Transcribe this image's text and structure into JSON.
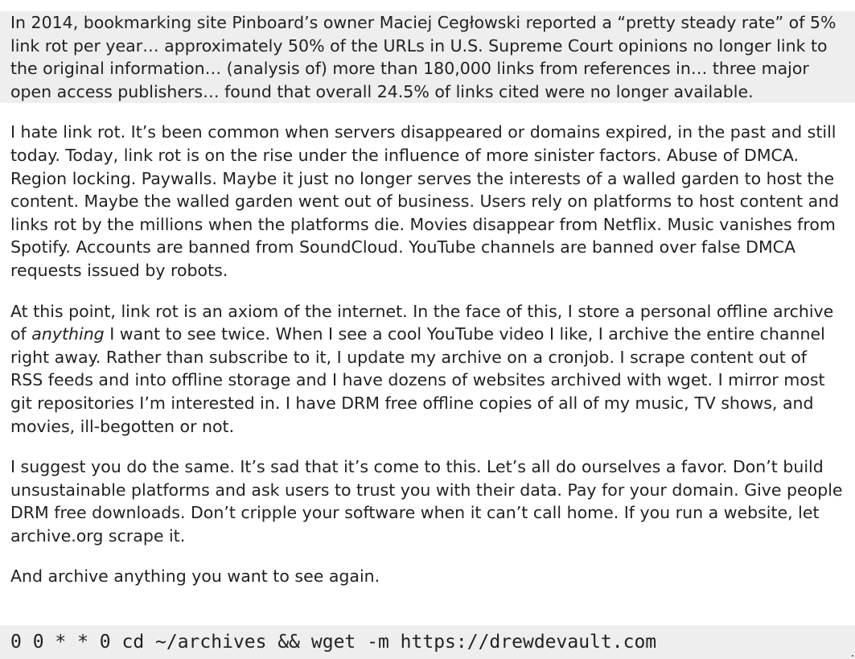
{
  "quote": "In 2014, bookmarking site Pinboard’s owner Maciej Cegłowski reported a “pretty steady rate” of 5% link rot per year… approximately 50% of the URLs in U.S. Supreme Court opinions no longer link to the original information… (analysis of) more than 180,000 links from references in… three major open access publishers… found that overall 24.5% of links cited were no longer available.",
  "paragraphs": {
    "p1": "I hate link rot. It’s been common when servers disappeared or domains expired, in the past and still today. Today, link rot is on the rise under the influence of more sinister factors. Abuse of DMCA. Region locking. Paywalls. Maybe it just no longer serves the interests of a walled garden to host the content. Maybe the walled garden went out of business. Users rely on platforms to host content and links rot by the millions when the platforms die. Movies disappear from Netflix. Music vanishes from Spotify. Accounts are banned from SoundCloud. YouTube channels are banned over false DMCA requests issued by robots.",
    "p2_before": "At this point, link rot is an axiom of the internet. In the face of this, I store a personal offline archive of ",
    "p2_emphasis": "anything",
    "p2_after": " I want to see twice. When I see a cool YouTube video I like, I archive the entire channel right away. Rather than subscribe to it, I update my archive on a cronjob. I scrape content out of RSS feeds and into offline storage and I have dozens of websites archived with wget. I mirror most git repositories I’m interested in. I have DRM free offline copies of all of my music, TV shows, and movies, ill-begotten or not.",
    "p3": "I suggest you do the same. It’s sad that it’s come to this. Let’s all do ourselves a favor. Don’t build unsustainable platforms and ask users to trust you with their data. Pay for your domain. Give people DRM free downloads. Don’t cripple your software when it can’t call home. If you run a website, let archive.org scrape it.",
    "p4": "And archive anything you want to see again."
  },
  "code": "0 0 * * 0 cd ~/archives && wget -m https://drewdevault.com"
}
